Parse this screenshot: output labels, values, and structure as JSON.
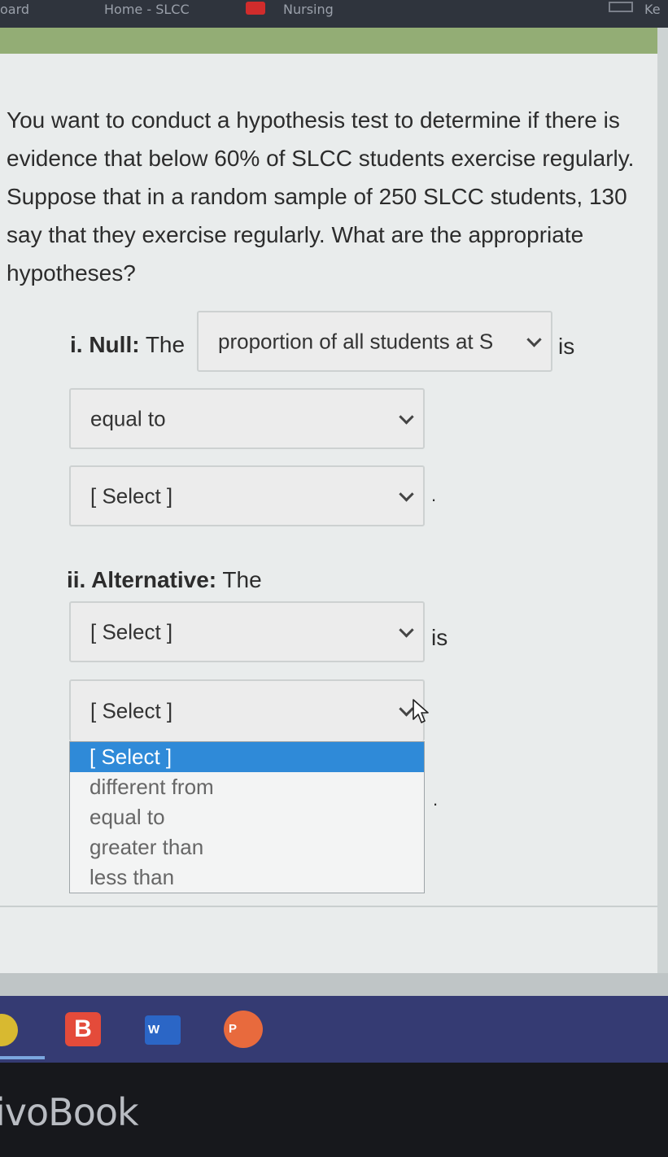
{
  "browser": {
    "tabs": [
      "oard",
      "Home - SLCC",
      "Nursing",
      "Ke"
    ]
  },
  "question": {
    "text": "You want to conduct a hypothesis test to determine if there is evidence that below 60% of SLCC students exercise regularly. Suppose that in a random sample of 250 SLCC students, 130 say that they exercise regularly. What are the appropriate hypotheses?"
  },
  "null": {
    "prefix": "i. Null:",
    "the": "The",
    "param_value": "proportion of all students at S",
    "is": "is",
    "relation_value": "equal to",
    "value_value": "[ Select ]",
    "period": "."
  },
  "alternative": {
    "prefix": "ii. Alternative:",
    "the": "The",
    "param_value": "[ Select ]",
    "is": "is",
    "relation_value": "[ Select ]",
    "period": "."
  },
  "relation_options": [
    "[ Select ]",
    "different from",
    "equal to",
    "greater than",
    "less than"
  ],
  "taskbar": {
    "b_label": "B",
    "w_label": "W",
    "p_label": "P"
  },
  "laptop_brand": "ivoBook",
  "colors": {
    "accent_highlight": "#2f8ad8",
    "header_green": "#93ad75",
    "taskbar": "#353b73"
  }
}
